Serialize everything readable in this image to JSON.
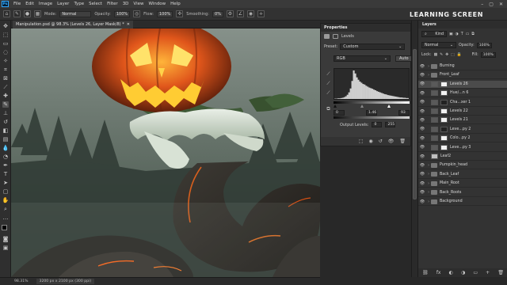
{
  "menu": {
    "logo": "Ps",
    "items": [
      "File",
      "Edit",
      "Image",
      "Layer",
      "Type",
      "Select",
      "Filter",
      "3D",
      "View",
      "Window",
      "Help"
    ],
    "win_buttons": [
      "–",
      "▢",
      "✕"
    ]
  },
  "options": {
    "mode_label": "Mode:",
    "mode_value": "Normal",
    "opacity_label": "Opacity:",
    "opacity_value": "100%",
    "flow_label": "Flow:",
    "flow_value": "100%",
    "smoothing_label": "Smoothing:",
    "smoothing_value": "0%"
  },
  "brand": "LEARNING SCREEN",
  "document": {
    "tab_title": "Manipulation.psd @ 98.3% (Levels 26, Layer Mask/8) *",
    "close": "✕"
  },
  "status": {
    "zoom": "98.31%",
    "docinfo": "3200 px x 2100 px (300 ppi)"
  },
  "properties": {
    "title": "Properties",
    "section": "Levels",
    "preset_label": "Preset:",
    "preset_value": "Custom",
    "channel_value": "RGB",
    "auto_label": "Auto",
    "input_levels": [
      "0",
      "1.46",
      "93"
    ],
    "output_label": "Output Levels:",
    "output_levels": [
      "0",
      "255"
    ],
    "histogram": [
      1,
      1,
      2,
      2,
      3,
      4,
      6,
      9,
      14,
      22,
      35,
      60,
      95,
      85,
      72,
      64,
      58,
      54,
      50,
      48,
      44,
      41,
      38,
      36,
      34,
      31,
      29,
      26,
      24,
      22,
      20,
      18,
      16,
      15,
      13,
      12,
      11,
      10,
      9,
      8,
      7,
      6,
      5,
      5,
      4,
      4,
      3,
      3
    ]
  },
  "layers": {
    "title": "Layers",
    "kind_label": "Kind",
    "blend_mode": "Normal",
    "opacity_label": "Opacity:",
    "opacity_value": "100%",
    "lock_label": "Lock:",
    "fill_label": "Fill:",
    "fill_value": "100%",
    "rows": [
      {
        "name": "Burning",
        "kind": "folder"
      },
      {
        "name": "Front_Leaf",
        "kind": "folder"
      },
      {
        "name": "Levels 26",
        "kind": "adj",
        "selected": true
      },
      {
        "name": "Hue/...n 6",
        "kind": "adj"
      },
      {
        "name": "Cha...xer 1",
        "kind": "adj"
      },
      {
        "name": "Levels 22",
        "kind": "adj"
      },
      {
        "name": "Levels 21",
        "kind": "adj"
      },
      {
        "name": "Leve...py 2",
        "kind": "adj"
      },
      {
        "name": "Colo...py 2",
        "kind": "adj"
      },
      {
        "name": "Leve...py 3",
        "kind": "adj"
      },
      {
        "name": "Leaf2",
        "kind": "image"
      },
      {
        "name": "Pumpkin_head",
        "kind": "folder"
      },
      {
        "name": "Back_Leaf",
        "kind": "folder"
      },
      {
        "name": "Main_Root",
        "kind": "folder"
      },
      {
        "name": "Back_Roots",
        "kind": "folder"
      },
      {
        "name": "Background",
        "kind": "folder"
      }
    ],
    "footer_icons": [
      "⛓",
      "fx",
      "◐",
      "◑",
      "▭",
      "+",
      "🗑"
    ]
  },
  "colors": {
    "accent": "#31a8ff",
    "selected_row": "#4b4b4b",
    "panel_bg": "#333333"
  }
}
